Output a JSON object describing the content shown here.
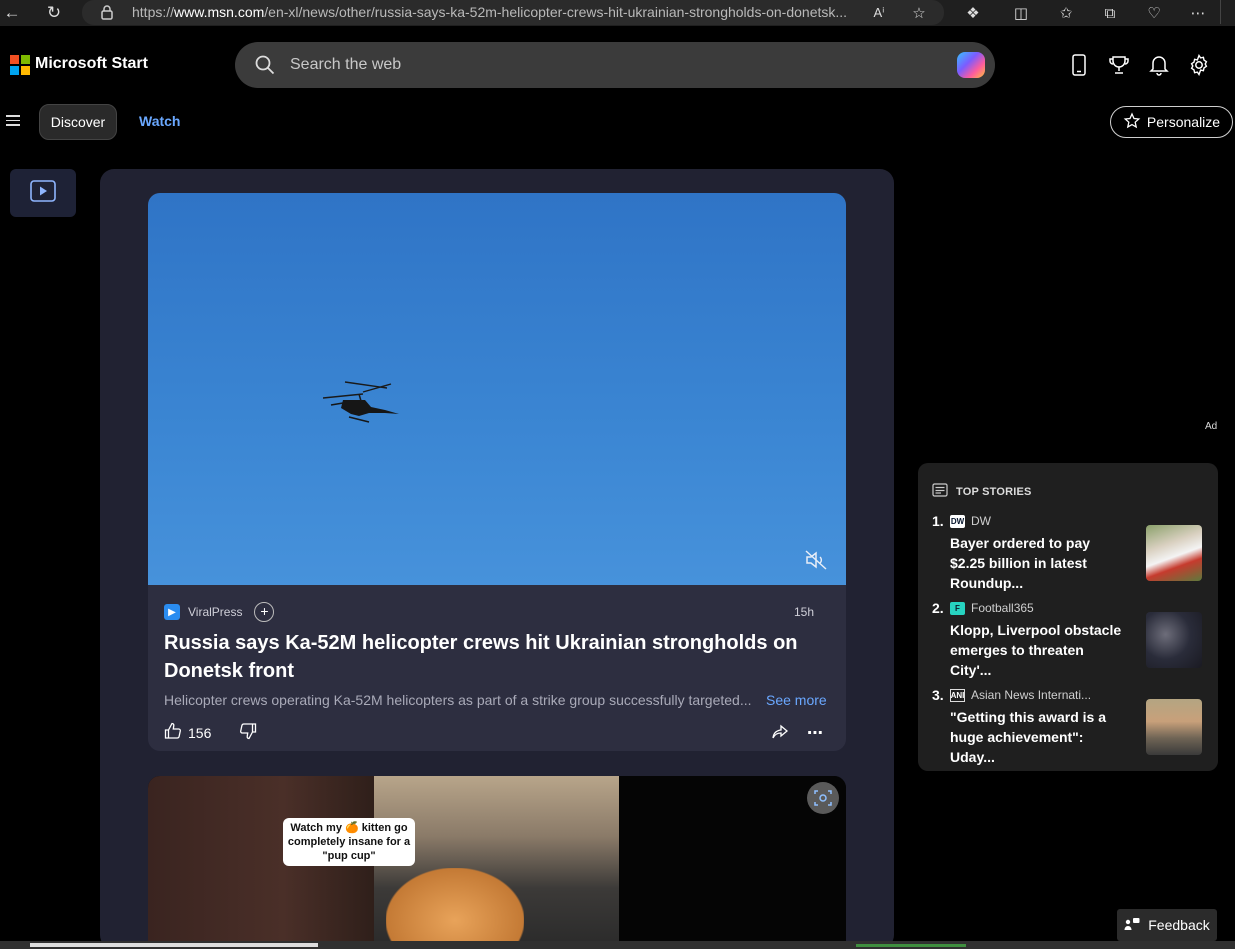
{
  "browser": {
    "url_prefix": "https://",
    "url_domain": "www.msn.com",
    "url_path": "/en-xl/news/other/russia-says-ka-52m-helicopter-crews-hit-ukrainian-strongholds-on-donetsk..."
  },
  "header": {
    "brand": "Microsoft Start",
    "search_placeholder": "Search the web",
    "logo_colors": [
      "#f25022",
      "#7fba00",
      "#00a4ef",
      "#ffb900"
    ]
  },
  "nav": {
    "discover_label": "Discover",
    "watch_label": "Watch",
    "personalize_label": "Personalize"
  },
  "main_card": {
    "source": "ViralPress",
    "age": "15h",
    "headline": "Russia says Ka-52M helicopter crews hit Ukrainian strongholds on Donetsk front",
    "abstract": "Helicopter crews operating Ka-52M helicopters as part of a strike group successfully targeted...",
    "see_more": "See more",
    "likes": "156"
  },
  "second_card": {
    "caption": "Watch my 🍊 kitten go completely insane for a \"pup cup\""
  },
  "right_rail": {
    "ad_label": "Ad",
    "top_stories_title": "TOP STORIES",
    "stories": [
      {
        "num": "1.",
        "source": "DW",
        "icon": "DW",
        "title": "Bayer ordered to pay $2.25 billion in latest Roundup..."
      },
      {
        "num": "2.",
        "source": "Football365",
        "icon": "F",
        "title": "Klopp, Liverpool obstacle emerges to threaten City'..."
      },
      {
        "num": "3.",
        "source": "Asian News Internati...",
        "icon": "ANI",
        "title": "\"Getting this award is a huge achievement\": Uday..."
      }
    ]
  },
  "feedback_label": "Feedback"
}
